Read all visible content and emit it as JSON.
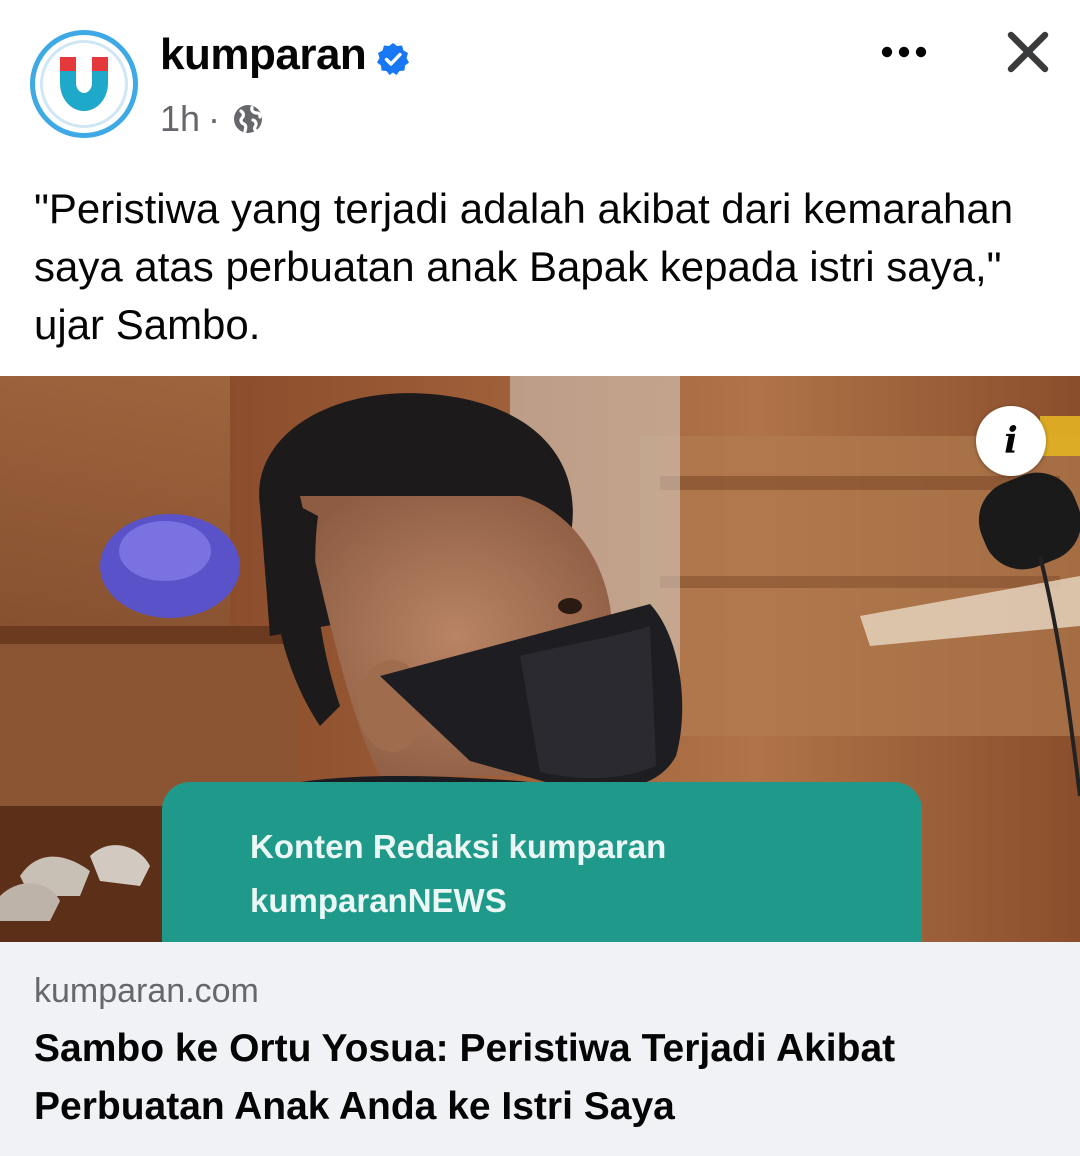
{
  "post": {
    "page_name": "kumparan",
    "timestamp": "1h",
    "separator": "·",
    "caption": "\"Peristiwa yang terjadi adalah akibat dari kemarahan saya atas perbuatan anak Bapak kepada istri saya,\" ujar Sambo.",
    "verified": true,
    "icons": {
      "avatar": "kumparan-logo-icon",
      "verified": "verified-badge-icon",
      "audience": "globe-icon",
      "more": "more-options-icon",
      "close": "close-icon",
      "info": "info-icon"
    }
  },
  "image": {
    "banner_line1": "Konten Redaksi kumparan",
    "banner_line2": "kumparanNEWS",
    "info_label": "i"
  },
  "link": {
    "domain": "kumparan.com",
    "title": "Sambo ke Ortu Yosua: Peristiwa Terjadi Akibat Perbuatan Anak Anda ke Istri Saya"
  },
  "colors": {
    "brand_blue": "#3fa9e6",
    "brand_red": "#e5383b",
    "banner_teal": "#1f9a8a",
    "verified_blue": "#1877f2",
    "secondary_text": "#65676b",
    "link_bg": "#f0f2f5"
  }
}
